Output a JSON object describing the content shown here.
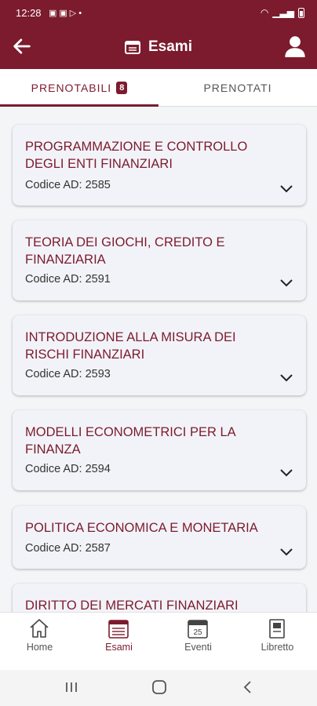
{
  "status_bar": {
    "time": "12:28"
  },
  "app_bar": {
    "title": "Esami"
  },
  "tabs": [
    {
      "label": "PRENOTABILI",
      "badge": "8"
    },
    {
      "label": "PRENOTATI"
    }
  ],
  "exams": [
    {
      "title": "PROGRAMMAZIONE E CONTROLLO DEGLI ENTI FINANZIARI",
      "code": "Codice AD: 2585"
    },
    {
      "title": "TEORIA DEI GIOCHI, CREDITO E FINANZIARIA",
      "code": "Codice AD: 2591"
    },
    {
      "title": "INTRODUZIONE ALLA MISURA DEI RISCHI FINANZIARI",
      "code": "Codice AD: 2593"
    },
    {
      "title": "MODELLI ECONOMETRICI PER LA FINANZA",
      "code": "Codice AD: 2594"
    },
    {
      "title": "POLITICA ECONOMICA E MONETARIA",
      "code": "Codice AD: 2587"
    },
    {
      "title": "DIRITTO DEI MERCATI FINANZIARI",
      "code": ""
    }
  ],
  "bottom_nav": [
    {
      "label": "Home",
      "icon": "home-icon"
    },
    {
      "label": "Esami",
      "icon": "exam-calendar-icon",
      "active": true
    },
    {
      "label": "Eventi",
      "icon": "events-calendar-icon",
      "date_text": "25"
    },
    {
      "label": "Libretto",
      "icon": "booklet-icon"
    }
  ],
  "colors": {
    "primary": "#7c1b2e",
    "card_bg": "#f2f3f8",
    "page_bg": "#f4f5f7"
  }
}
